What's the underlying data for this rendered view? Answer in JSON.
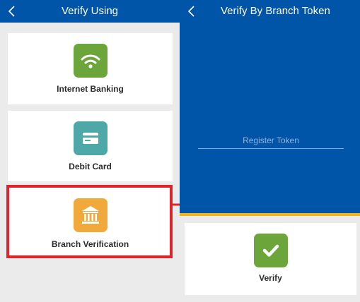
{
  "left_screen": {
    "title": "Verify Using",
    "options": [
      {
        "label": "Internet Banking",
        "icon": "wifi-icon",
        "color": "#6ca63a"
      },
      {
        "label": "Debit Card",
        "icon": "credit-card-icon",
        "color": "#4fa8a8"
      },
      {
        "label": "Branch Verification",
        "icon": "bank-building-icon",
        "color": "#f2a93b"
      }
    ],
    "highlighted_option": "Branch Verification",
    "highlight_color": "#e0242c"
  },
  "right_screen": {
    "title": "Verify By Branch Token",
    "token_input": {
      "placeholder": "Register Token",
      "value": ""
    },
    "verify_button": {
      "label": "Verify",
      "icon": "checkmark-icon",
      "color": "#6ca63a"
    }
  },
  "colors": {
    "header": "#0055a8",
    "accent_bar": "#f2b41b",
    "background": "#ebebeb"
  },
  "arrow_icon": "right-arrow-icon"
}
